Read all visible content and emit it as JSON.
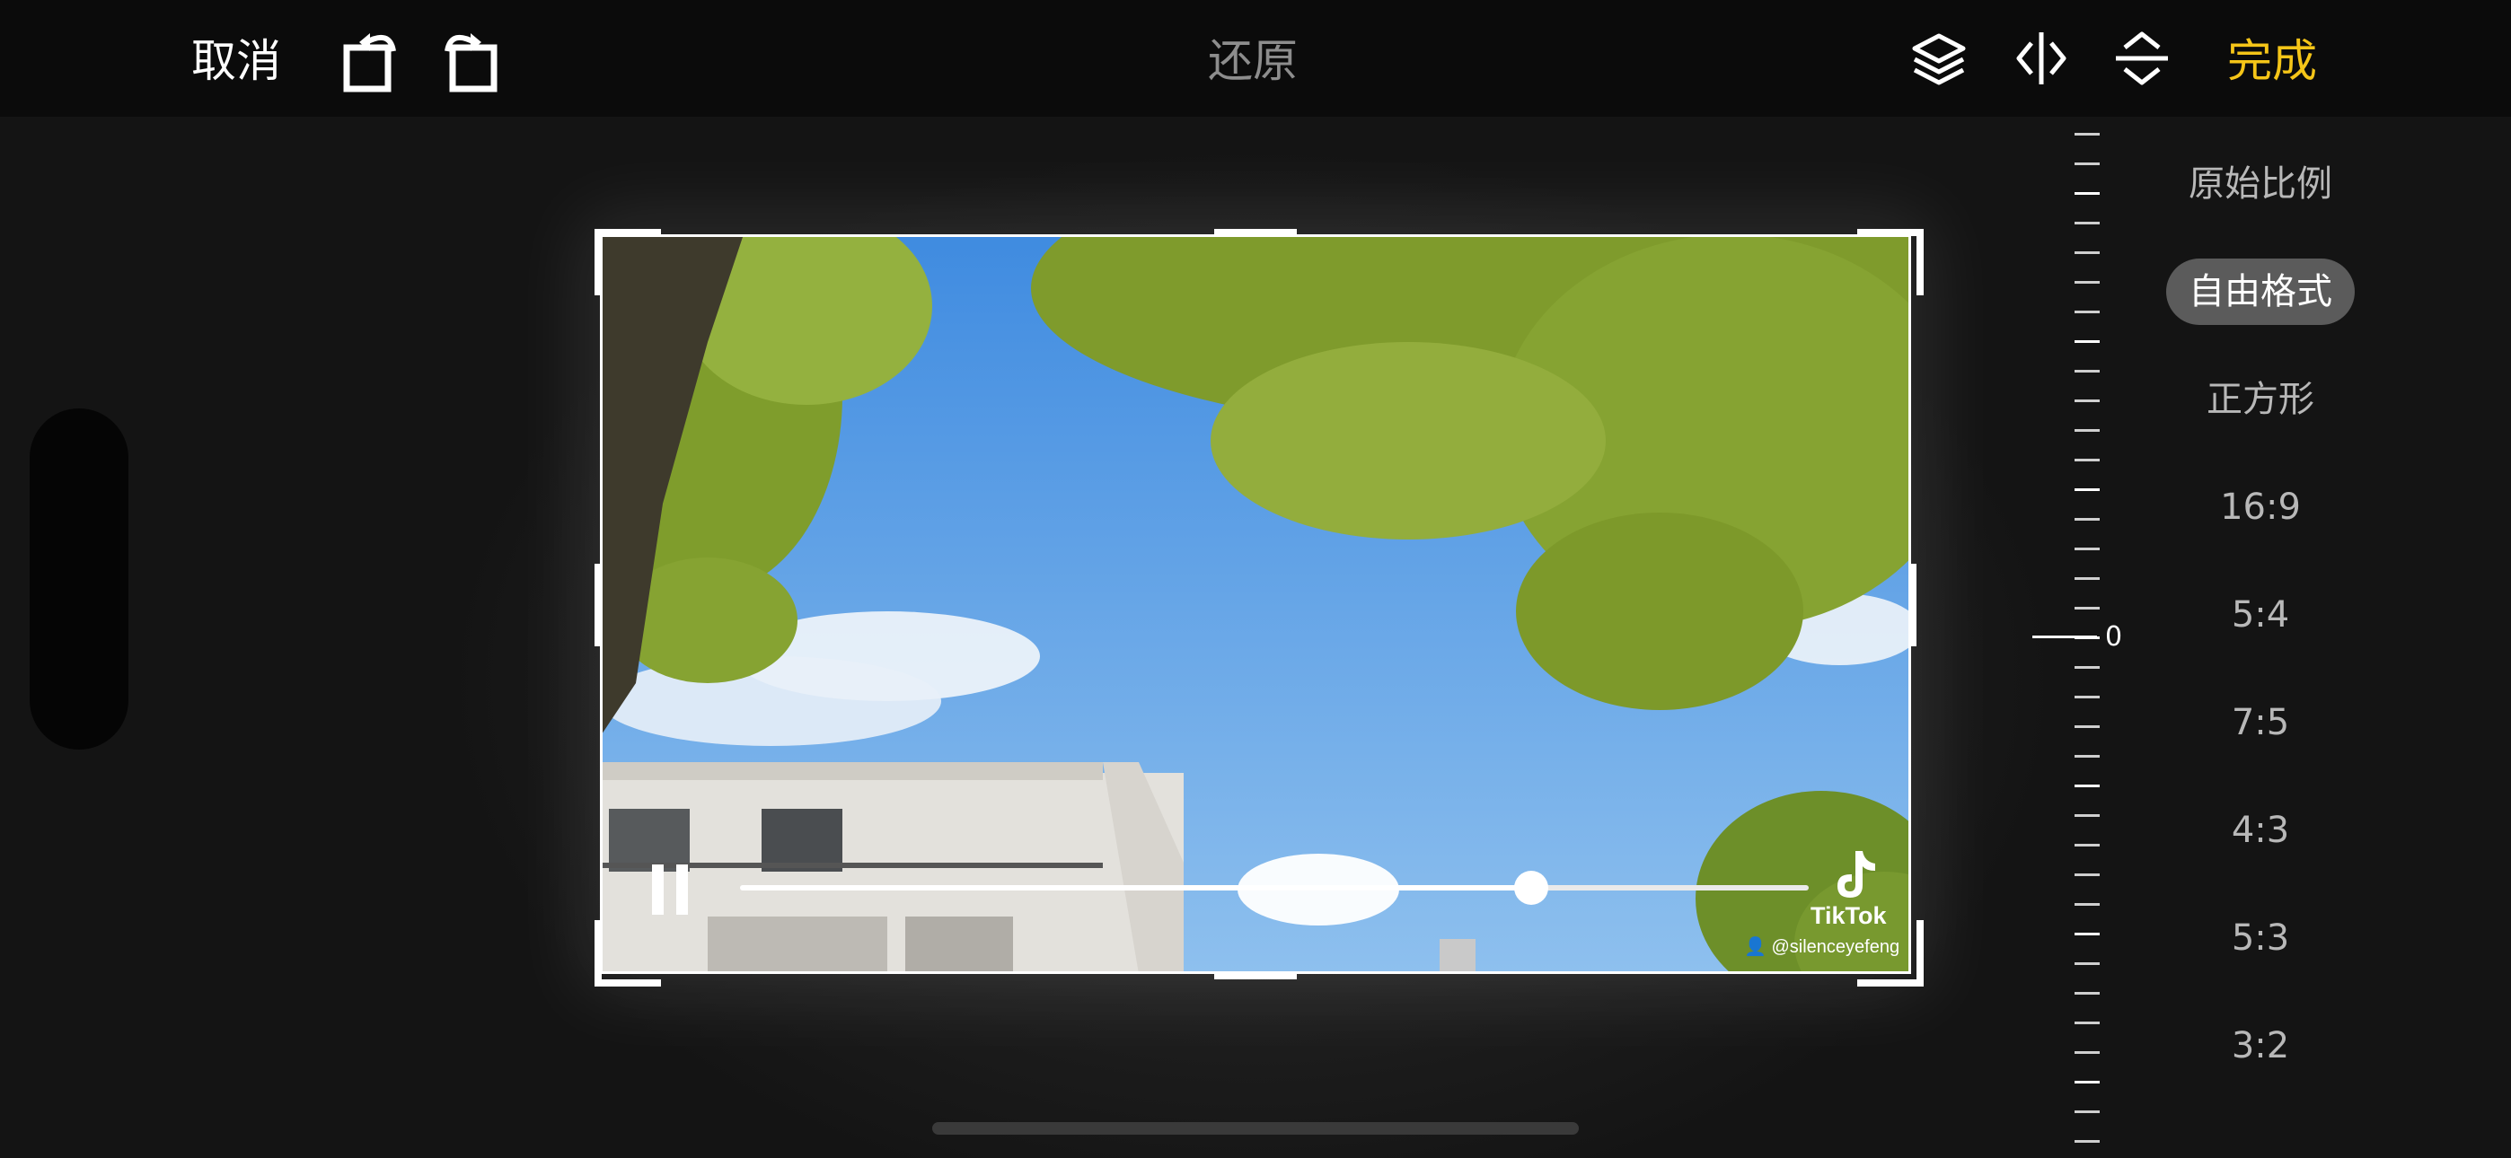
{
  "toolbar": {
    "cancel_label": "取消",
    "restore_label": "还原",
    "done_label": "完成",
    "done_color": "#f5c518",
    "icons": [
      "rotate-left-icon",
      "rotate-right-icon",
      "layers-icon",
      "flip-horizontal-icon",
      "flip-vertical-icon"
    ]
  },
  "video": {
    "playback_state": "playing",
    "progress": 0.74,
    "watermark": {
      "brand": "TikTok",
      "user": "@silenceyefeng"
    }
  },
  "rotation": {
    "angle_label": "0"
  },
  "aspect_ratios": {
    "selected": "自由格式",
    "items": [
      "原始比例",
      "自由格式",
      "正方形",
      "16:9",
      "5:4",
      "7:5",
      "4:3",
      "5:3",
      "3:2"
    ]
  }
}
